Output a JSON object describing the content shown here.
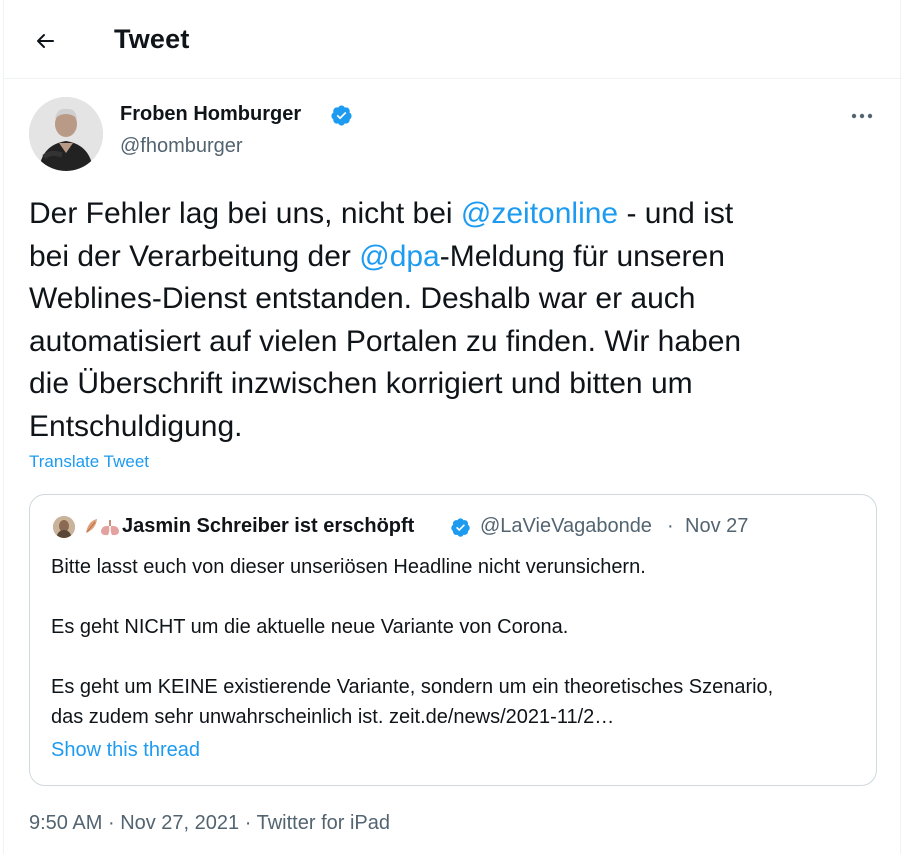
{
  "header": {
    "title": "Tweet"
  },
  "tweet": {
    "author": {
      "name": "Froben Homburger",
      "handle": "@fhomburger",
      "verified": true
    },
    "text_lines": [
      [
        "Der Fehler lag bei uns, nicht bei ",
        "@zeitonline",
        " - und ist"
      ],
      [
        "bei der Verarbeitung der ",
        "@dpa",
        "-Meldung für unseren"
      ],
      [
        "Weblines-Dienst entstanden. Deshalb war er auch"
      ],
      [
        "automatisiert auf vielen Portalen zu finden. Wir haben"
      ],
      [
        "die Überschrift inzwischen korrigiert und bitten um"
      ],
      [
        "Entschuldigung."
      ]
    ],
    "translate_label": "Translate Tweet",
    "time": "9:50 AM",
    "date": "Nov 27, 2021",
    "source": "Twitter for iPad",
    "separator": "·"
  },
  "quoted_tweet": {
    "author_name": "Jasmin Schreiber ist erschöpft",
    "author_handle": "@LaVieVagabonde",
    "verified": true,
    "separator": "·",
    "date": "Nov 27",
    "emoji_icons": [
      "leaf-icon",
      "lungs-icon"
    ],
    "paragraphs": [
      [
        "Bitte lasst euch von dieser unseriösen Headline nicht verunsichern."
      ],
      [
        "Es geht NICHT um die aktuelle neue Variante von Corona."
      ],
      [
        "Es geht um KEINE existierende Variante, sondern um ein theoretisches Szenario,",
        "das zudem sehr unwahrscheinlich ist. zeit.de/news/2021-11/2…"
      ]
    ],
    "show_thread_label": "Show this thread"
  },
  "colors": {
    "accent": "#1d9bf0",
    "secondary_text": "#536471",
    "primary_text": "#0f1419",
    "border": "#cfd9de"
  }
}
